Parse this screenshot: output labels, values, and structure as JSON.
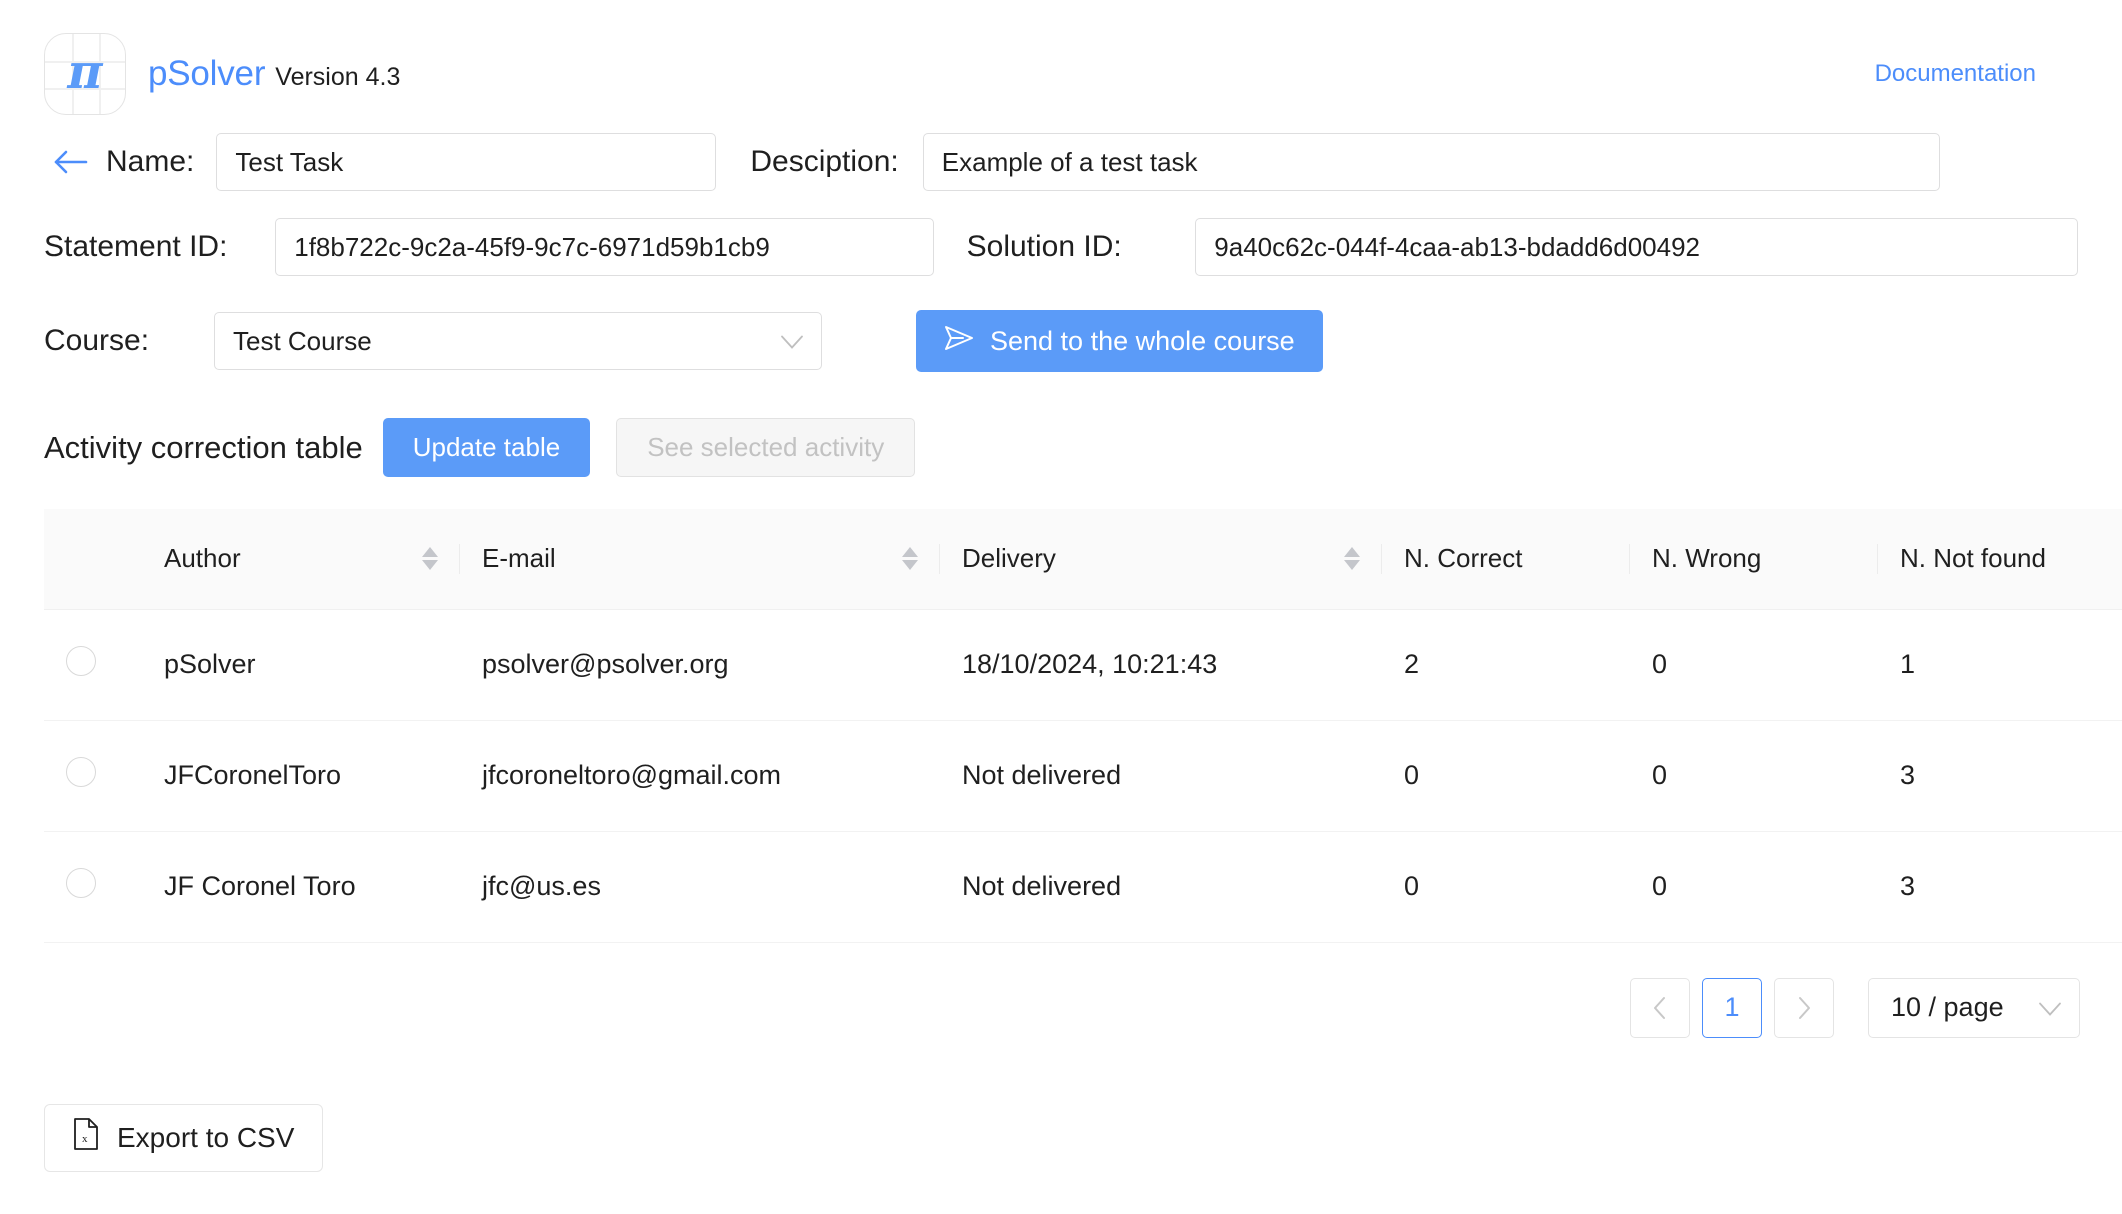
{
  "header": {
    "logo_icon": "pi-grid-logo-icon",
    "pi_symbol": "π",
    "brand_name": "pSolver",
    "version": "Version 4.3",
    "documentation_link": "Documentation",
    "brand_color": "#4c8dfb"
  },
  "form": {
    "back_icon": "←",
    "name_label": "Name:",
    "name_value": "Test Task",
    "description_label": "Desciption:",
    "description_value": "Example of a test task",
    "statement_id_label": "Statement ID:",
    "statement_id_value": "1f8b722c-9c2a-45f9-9c7c-6971d59b1cb9",
    "solution_id_label": "Solution ID:",
    "solution_id_value": "9a40c62c-044f-4caa-ab13-bdadd6d00492",
    "course_label": "Course:",
    "course_value": "Test Course",
    "send_button_label": "Send to the whole course",
    "send_icon": "send-icon",
    "chevron_icon": "chevron-down-icon"
  },
  "table_section": {
    "title": "Activity correction table",
    "update_button_label": "Update table",
    "see_activity_button_label": "See selected activity",
    "see_activity_disabled": true,
    "columns": [
      {
        "label": "Author",
        "sortable": true
      },
      {
        "label": "E-mail",
        "sortable": true
      },
      {
        "label": "Delivery",
        "sortable": true
      },
      {
        "label": "N. Correct",
        "sortable": false
      },
      {
        "label": "N. Wrong",
        "sortable": false
      },
      {
        "label": "N. Not found",
        "sortable": false
      }
    ],
    "rows": [
      {
        "selected": false,
        "author": "pSolver",
        "email": "psolver@psolver.org",
        "delivery": "18/10/2024, 10:21:43",
        "n_correct": "2",
        "n_wrong": "0",
        "n_not_found": "1"
      },
      {
        "selected": false,
        "author": "JFCoronelToro",
        "email": "jfcoroneltoro@gmail.com",
        "delivery": "Not delivered",
        "n_correct": "0",
        "n_wrong": "0",
        "n_not_found": "3"
      },
      {
        "selected": false,
        "author": "JF Coronel Toro",
        "email": "jfc@us.es",
        "delivery": "Not delivered",
        "n_correct": "0",
        "n_wrong": "0",
        "n_not_found": "3"
      }
    ]
  },
  "pagination": {
    "prev_icon": "‹",
    "next_icon": "›",
    "current_page": "1",
    "page_size": "10 / page",
    "chevron_icon": "chevron-down-icon"
  },
  "footer": {
    "export_label": "Export to CSV",
    "export_icon": "csv-file-icon"
  }
}
